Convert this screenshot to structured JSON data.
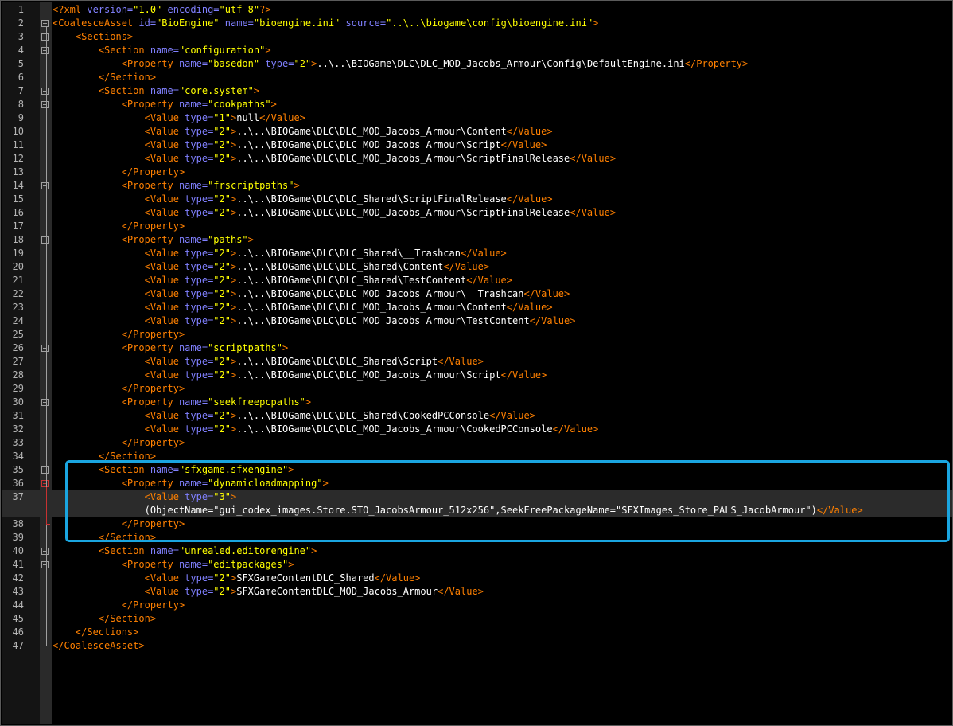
{
  "editor": {
    "lines": [
      {
        "n": "1",
        "c": [
          [
            "t",
            "<?xml "
          ],
          [
            "a",
            "version="
          ],
          [
            "v",
            "\"1.0\""
          ],
          [
            "a",
            " encoding="
          ],
          [
            "v",
            "\"utf-8\""
          ],
          [
            "t",
            "?>"
          ]
        ]
      },
      {
        "n": "2",
        "c": [
          [
            "t",
            "<CoalesceAsset "
          ],
          [
            "a",
            "id="
          ],
          [
            "v",
            "\"BioEngine\""
          ],
          [
            "a",
            " name="
          ],
          [
            "v",
            "\"bioengine.ini\""
          ],
          [
            "a",
            " source="
          ],
          [
            "v",
            "\"..\\..\\biogame\\config\\bioengine.ini\""
          ],
          [
            "t",
            ">"
          ]
        ]
      },
      {
        "n": "3",
        "c": [
          [
            "d",
            "    "
          ],
          [
            "t",
            "<Sections>"
          ]
        ]
      },
      {
        "n": "4",
        "c": [
          [
            "d",
            "        "
          ],
          [
            "t",
            "<Section "
          ],
          [
            "a",
            "name="
          ],
          [
            "v",
            "\"configuration\""
          ],
          [
            "t",
            ">"
          ]
        ]
      },
      {
        "n": "5",
        "c": [
          [
            "d",
            "            "
          ],
          [
            "t",
            "<Property "
          ],
          [
            "a",
            "name="
          ],
          [
            "v",
            "\"basedon\""
          ],
          [
            "a",
            " type="
          ],
          [
            "v",
            "\"2\""
          ],
          [
            "t",
            ">"
          ],
          [
            "d",
            "..\\..\\BIOGame\\DLC\\DLC_MOD_Jacobs_Armour\\Config\\DefaultEngine.ini"
          ],
          [
            "t",
            "</Property>"
          ]
        ]
      },
      {
        "n": "6",
        "c": [
          [
            "d",
            "        "
          ],
          [
            "t",
            "</Section>"
          ]
        ]
      },
      {
        "n": "7",
        "c": [
          [
            "d",
            "        "
          ],
          [
            "t",
            "<Section "
          ],
          [
            "a",
            "name="
          ],
          [
            "v",
            "\"core.system\""
          ],
          [
            "t",
            ">"
          ]
        ]
      },
      {
        "n": "8",
        "c": [
          [
            "d",
            "            "
          ],
          [
            "t",
            "<Property "
          ],
          [
            "a",
            "name="
          ],
          [
            "v",
            "\"cookpaths\""
          ],
          [
            "t",
            ">"
          ]
        ]
      },
      {
        "n": "9",
        "c": [
          [
            "d",
            "                "
          ],
          [
            "t",
            "<Value "
          ],
          [
            "a",
            "type="
          ],
          [
            "v",
            "\"1\""
          ],
          [
            "t",
            ">"
          ],
          [
            "d",
            "null"
          ],
          [
            "t",
            "</Value>"
          ]
        ]
      },
      {
        "n": "10",
        "c": [
          [
            "d",
            "                "
          ],
          [
            "t",
            "<Value "
          ],
          [
            "a",
            "type="
          ],
          [
            "v",
            "\"2\""
          ],
          [
            "t",
            ">"
          ],
          [
            "d",
            "..\\..\\BIOGame\\DLC\\DLC_MOD_Jacobs_Armour\\Content"
          ],
          [
            "t",
            "</Value>"
          ]
        ]
      },
      {
        "n": "11",
        "c": [
          [
            "d",
            "                "
          ],
          [
            "t",
            "<Value "
          ],
          [
            "a",
            "type="
          ],
          [
            "v",
            "\"2\""
          ],
          [
            "t",
            ">"
          ],
          [
            "d",
            "..\\..\\BIOGame\\DLC\\DLC_MOD_Jacobs_Armour\\Script"
          ],
          [
            "t",
            "</Value>"
          ]
        ]
      },
      {
        "n": "12",
        "c": [
          [
            "d",
            "                "
          ],
          [
            "t",
            "<Value "
          ],
          [
            "a",
            "type="
          ],
          [
            "v",
            "\"2\""
          ],
          [
            "t",
            ">"
          ],
          [
            "d",
            "..\\..\\BIOGame\\DLC\\DLC_MOD_Jacobs_Armour\\ScriptFinalRelease"
          ],
          [
            "t",
            "</Value>"
          ]
        ]
      },
      {
        "n": "13",
        "c": [
          [
            "d",
            "            "
          ],
          [
            "t",
            "</Property>"
          ]
        ]
      },
      {
        "n": "14",
        "c": [
          [
            "d",
            "            "
          ],
          [
            "t",
            "<Property "
          ],
          [
            "a",
            "name="
          ],
          [
            "v",
            "\"frscriptpaths\""
          ],
          [
            "t",
            ">"
          ]
        ]
      },
      {
        "n": "15",
        "c": [
          [
            "d",
            "                "
          ],
          [
            "t",
            "<Value "
          ],
          [
            "a",
            "type="
          ],
          [
            "v",
            "\"2\""
          ],
          [
            "t",
            ">"
          ],
          [
            "d",
            "..\\..\\BIOGame\\DLC\\DLC_Shared\\ScriptFinalRelease"
          ],
          [
            "t",
            "</Value>"
          ]
        ]
      },
      {
        "n": "16",
        "c": [
          [
            "d",
            "                "
          ],
          [
            "t",
            "<Value "
          ],
          [
            "a",
            "type="
          ],
          [
            "v",
            "\"2\""
          ],
          [
            "t",
            ">"
          ],
          [
            "d",
            "..\\..\\BIOGame\\DLC\\DLC_MOD_Jacobs_Armour\\ScriptFinalRelease"
          ],
          [
            "t",
            "</Value>"
          ]
        ]
      },
      {
        "n": "17",
        "c": [
          [
            "d",
            "            "
          ],
          [
            "t",
            "</Property>"
          ]
        ]
      },
      {
        "n": "18",
        "c": [
          [
            "d",
            "            "
          ],
          [
            "t",
            "<Property "
          ],
          [
            "a",
            "name="
          ],
          [
            "v",
            "\"paths\""
          ],
          [
            "t",
            ">"
          ]
        ]
      },
      {
        "n": "19",
        "c": [
          [
            "d",
            "                "
          ],
          [
            "t",
            "<Value "
          ],
          [
            "a",
            "type="
          ],
          [
            "v",
            "\"2\""
          ],
          [
            "t",
            ">"
          ],
          [
            "d",
            "..\\..\\BIOGame\\DLC\\DLC_Shared\\__Trashcan"
          ],
          [
            "t",
            "</Value>"
          ]
        ]
      },
      {
        "n": "20",
        "c": [
          [
            "d",
            "                "
          ],
          [
            "t",
            "<Value "
          ],
          [
            "a",
            "type="
          ],
          [
            "v",
            "\"2\""
          ],
          [
            "t",
            ">"
          ],
          [
            "d",
            "..\\..\\BIOGame\\DLC\\DLC_Shared\\Content"
          ],
          [
            "t",
            "</Value>"
          ]
        ]
      },
      {
        "n": "21",
        "c": [
          [
            "d",
            "                "
          ],
          [
            "t",
            "<Value "
          ],
          [
            "a",
            "type="
          ],
          [
            "v",
            "\"2\""
          ],
          [
            "t",
            ">"
          ],
          [
            "d",
            "..\\..\\BIOGame\\DLC\\DLC_Shared\\TestContent"
          ],
          [
            "t",
            "</Value>"
          ]
        ]
      },
      {
        "n": "22",
        "c": [
          [
            "d",
            "                "
          ],
          [
            "t",
            "<Value "
          ],
          [
            "a",
            "type="
          ],
          [
            "v",
            "\"2\""
          ],
          [
            "t",
            ">"
          ],
          [
            "d",
            "..\\..\\BIOGame\\DLC\\DLC_MOD_Jacobs_Armour\\__Trashcan"
          ],
          [
            "t",
            "</Value>"
          ]
        ]
      },
      {
        "n": "23",
        "c": [
          [
            "d",
            "                "
          ],
          [
            "t",
            "<Value "
          ],
          [
            "a",
            "type="
          ],
          [
            "v",
            "\"2\""
          ],
          [
            "t",
            ">"
          ],
          [
            "d",
            "..\\..\\BIOGame\\DLC\\DLC_MOD_Jacobs_Armour\\Content"
          ],
          [
            "t",
            "</Value>"
          ]
        ]
      },
      {
        "n": "24",
        "c": [
          [
            "d",
            "                "
          ],
          [
            "t",
            "<Value "
          ],
          [
            "a",
            "type="
          ],
          [
            "v",
            "\"2\""
          ],
          [
            "t",
            ">"
          ],
          [
            "d",
            "..\\..\\BIOGame\\DLC\\DLC_MOD_Jacobs_Armour\\TestContent"
          ],
          [
            "t",
            "</Value>"
          ]
        ]
      },
      {
        "n": "25",
        "c": [
          [
            "d",
            "            "
          ],
          [
            "t",
            "</Property>"
          ]
        ]
      },
      {
        "n": "26",
        "c": [
          [
            "d",
            "            "
          ],
          [
            "t",
            "<Property "
          ],
          [
            "a",
            "name="
          ],
          [
            "v",
            "\"scriptpaths\""
          ],
          [
            "t",
            ">"
          ]
        ]
      },
      {
        "n": "27",
        "c": [
          [
            "d",
            "                "
          ],
          [
            "t",
            "<Value "
          ],
          [
            "a",
            "type="
          ],
          [
            "v",
            "\"2\""
          ],
          [
            "t",
            ">"
          ],
          [
            "d",
            "..\\..\\BIOGame\\DLC\\DLC_Shared\\Script"
          ],
          [
            "t",
            "</Value>"
          ]
        ]
      },
      {
        "n": "28",
        "c": [
          [
            "d",
            "                "
          ],
          [
            "t",
            "<Value "
          ],
          [
            "a",
            "type="
          ],
          [
            "v",
            "\"2\""
          ],
          [
            "t",
            ">"
          ],
          [
            "d",
            "..\\..\\BIOGame\\DLC\\DLC_MOD_Jacobs_Armour\\Script"
          ],
          [
            "t",
            "</Value>"
          ]
        ]
      },
      {
        "n": "29",
        "c": [
          [
            "d",
            "            "
          ],
          [
            "t",
            "</Property>"
          ]
        ]
      },
      {
        "n": "30",
        "c": [
          [
            "d",
            "            "
          ],
          [
            "t",
            "<Property "
          ],
          [
            "a",
            "name="
          ],
          [
            "v",
            "\"seekfreepcpaths\""
          ],
          [
            "t",
            ">"
          ]
        ]
      },
      {
        "n": "31",
        "c": [
          [
            "d",
            "                "
          ],
          [
            "t",
            "<Value "
          ],
          [
            "a",
            "type="
          ],
          [
            "v",
            "\"2\""
          ],
          [
            "t",
            ">"
          ],
          [
            "d",
            "..\\..\\BIOGame\\DLC\\DLC_Shared\\CookedPCConsole"
          ],
          [
            "t",
            "</Value>"
          ]
        ]
      },
      {
        "n": "32",
        "c": [
          [
            "d",
            "                "
          ],
          [
            "t",
            "<Value "
          ],
          [
            "a",
            "type="
          ],
          [
            "v",
            "\"2\""
          ],
          [
            "t",
            ">"
          ],
          [
            "d",
            "..\\..\\BIOGame\\DLC\\DLC_MOD_Jacobs_Armour\\CookedPCConsole"
          ],
          [
            "t",
            "</Value>"
          ]
        ]
      },
      {
        "n": "33",
        "c": [
          [
            "d",
            "            "
          ],
          [
            "t",
            "</Property>"
          ]
        ]
      },
      {
        "n": "34",
        "c": [
          [
            "d",
            "        "
          ],
          [
            "t",
            "</Section>"
          ]
        ]
      },
      {
        "n": "35",
        "c": [
          [
            "d",
            "        "
          ],
          [
            "t",
            "<Section "
          ],
          [
            "a",
            "name="
          ],
          [
            "v",
            "\"sfxgame.sfxengine\""
          ],
          [
            "t",
            ">"
          ]
        ]
      },
      {
        "n": "36",
        "c": [
          [
            "d",
            "            "
          ],
          [
            "t",
            "<Property "
          ],
          [
            "a",
            "name="
          ],
          [
            "v",
            "\"dynamicloadmapping\""
          ],
          [
            "t",
            ">"
          ]
        ]
      },
      {
        "n": "37",
        "c": [
          [
            "d",
            "                "
          ],
          [
            "t",
            "<Value "
          ],
          [
            "a",
            "type="
          ],
          [
            "v",
            "\"3\""
          ],
          [
            "t",
            ">"
          ]
        ]
      },
      {
        "n": "",
        "c": [
          [
            "d",
            "                (ObjectName=\"gui_codex_images.Store.STO_JacobsArmour_512x256\",SeekFreePackageName=\"SFXImages_Store_PALS_JacobArmour\")"
          ],
          [
            "t",
            "</Value>"
          ]
        ]
      },
      {
        "n": "38",
        "c": [
          [
            "d",
            "            "
          ],
          [
            "t",
            "</Property>"
          ]
        ]
      },
      {
        "n": "39",
        "c": [
          [
            "d",
            "        "
          ],
          [
            "t",
            "</Section>"
          ]
        ]
      },
      {
        "n": "40",
        "c": [
          [
            "d",
            "        "
          ],
          [
            "t",
            "<Section "
          ],
          [
            "a",
            "name="
          ],
          [
            "v",
            "\"unrealed.editorengine\""
          ],
          [
            "t",
            ">"
          ]
        ]
      },
      {
        "n": "41",
        "c": [
          [
            "d",
            "            "
          ],
          [
            "t",
            "<Property "
          ],
          [
            "a",
            "name="
          ],
          [
            "v",
            "\"editpackages\""
          ],
          [
            "t",
            ">"
          ]
        ]
      },
      {
        "n": "42",
        "c": [
          [
            "d",
            "                "
          ],
          [
            "t",
            "<Value "
          ],
          [
            "a",
            "type="
          ],
          [
            "v",
            "\"2\""
          ],
          [
            "t",
            ">"
          ],
          [
            "d",
            "SFXGameContentDLC_Shared"
          ],
          [
            "t",
            "</Value>"
          ]
        ]
      },
      {
        "n": "43",
        "c": [
          [
            "d",
            "                "
          ],
          [
            "t",
            "<Value "
          ],
          [
            "a",
            "type="
          ],
          [
            "v",
            "\"2\""
          ],
          [
            "t",
            ">"
          ],
          [
            "d",
            "SFXGameContentDLC_MOD_Jacobs_Armour"
          ],
          [
            "t",
            "</Value>"
          ]
        ]
      },
      {
        "n": "44",
        "c": [
          [
            "d",
            "            "
          ],
          [
            "t",
            "</Property>"
          ]
        ]
      },
      {
        "n": "45",
        "c": [
          [
            "d",
            "        "
          ],
          [
            "t",
            "</Section>"
          ]
        ]
      },
      {
        "n": "46",
        "c": [
          [
            "d",
            "    "
          ],
          [
            "t",
            "</Sections>"
          ]
        ]
      },
      {
        "n": "47",
        "c": [
          [
            "t",
            "</CoalesceAsset>"
          ]
        ]
      }
    ],
    "colors": {
      "tag": "#ff8000",
      "attribute": "#8080ff",
      "attribute_value": "#ffff00",
      "text": "#ffffff",
      "background": "#000000",
      "highlight_box": "#1aa5e0"
    },
    "fold_icon": "minus-box-icon"
  }
}
